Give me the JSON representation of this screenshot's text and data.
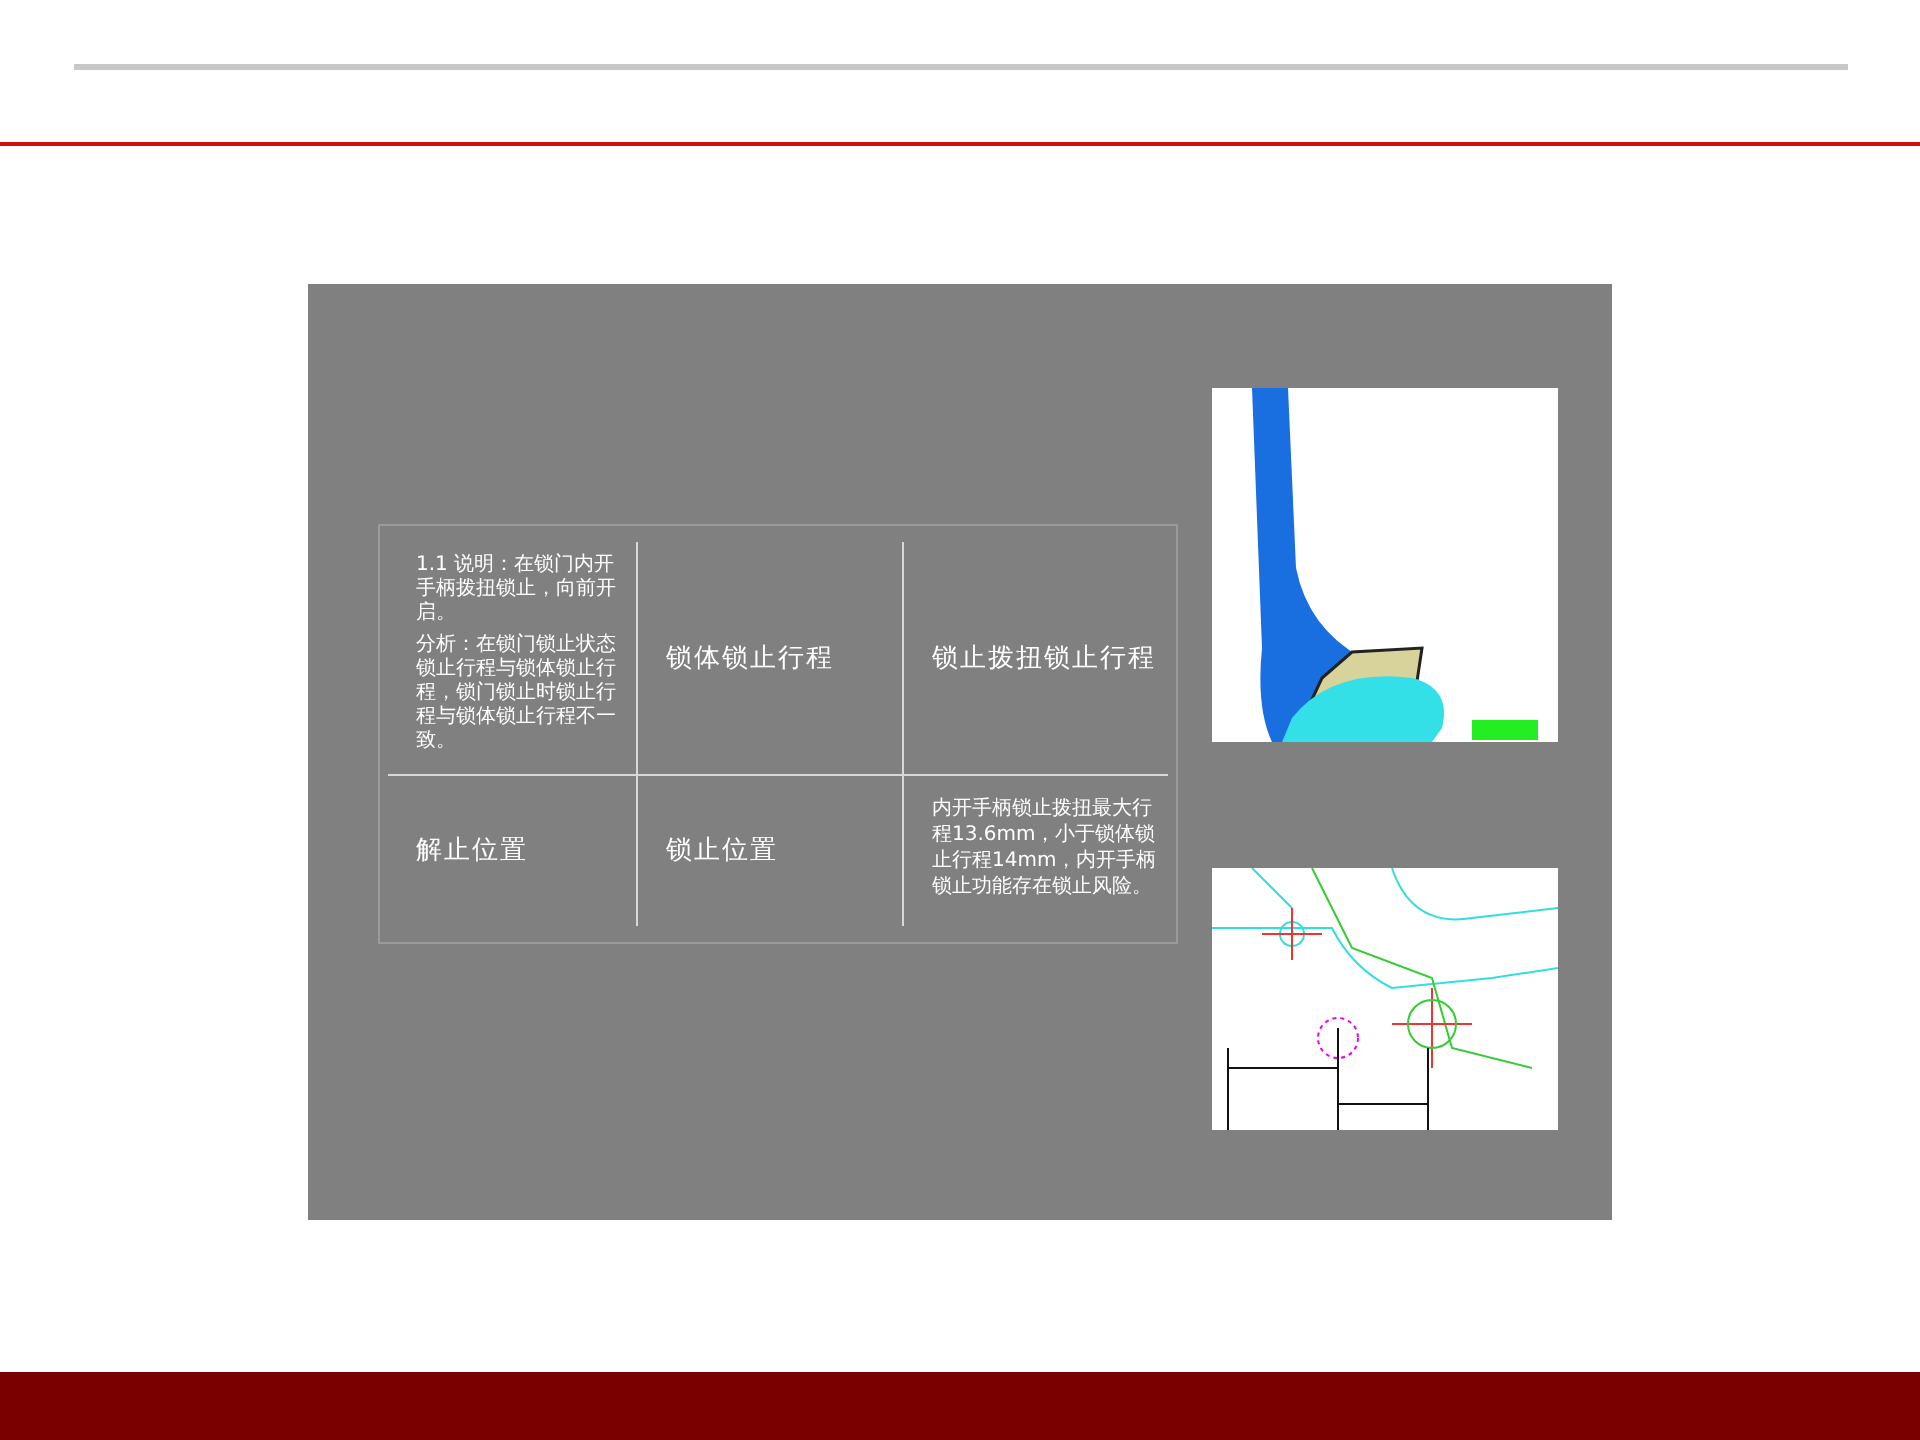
{
  "table": {
    "rows": [
      {
        "cells": [
          {
            "kind": "note",
            "paragraphs": [
              "1.1 说明：在锁门内开手柄拨扭锁止，向前开启。",
              "分析：在锁门锁止状态锁止行程与锁体锁止行程，锁门锁止时锁止行程与锁体锁止行程不一致。"
            ]
          },
          {
            "kind": "label",
            "text": "锁体锁止行程"
          },
          {
            "kind": "label",
            "text": "锁止拨扭锁止行程"
          }
        ]
      },
      {
        "cells": [
          {
            "kind": "label",
            "text": "解止位置"
          },
          {
            "kind": "label",
            "text": "锁止位置"
          },
          {
            "kind": "note",
            "paragraphs": [
              "内开手柄锁止拨扭最大行程13.6mm，小于锁体锁止行程14mm，内开手柄锁止功能存在锁止风险。"
            ]
          }
        ]
      }
    ]
  }
}
